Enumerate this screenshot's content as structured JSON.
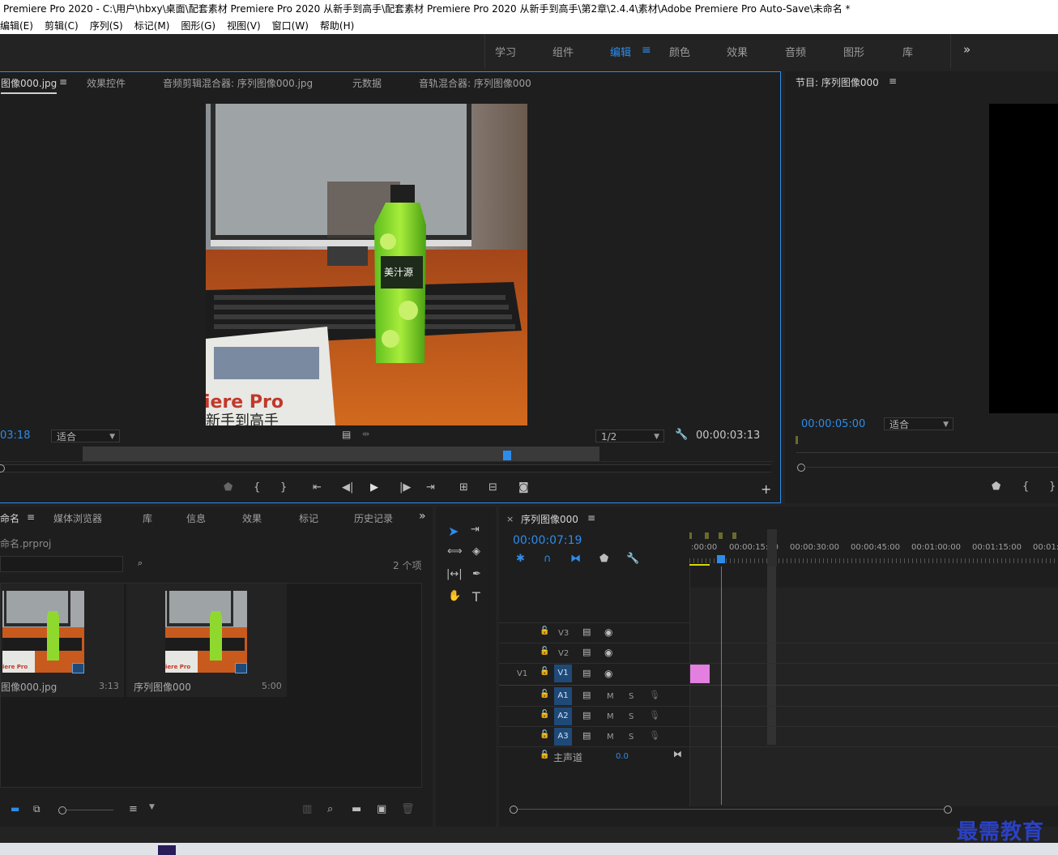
{
  "window": {
    "title": "Premiere Pro 2020 - C:\\用户\\hbxy\\桌面\\配套素材 Premiere Pro 2020 从新手到高手\\配套素材 Premiere Pro 2020 从新手到高手\\第2章\\2.4.4\\素材\\Adobe Premiere Pro Auto-Save\\未命名 *"
  },
  "menu": [
    "编辑(E)",
    "剪辑(C)",
    "序列(S)",
    "标记(M)",
    "图形(G)",
    "视图(V)",
    "窗口(W)",
    "帮助(H)"
  ],
  "workspaces": {
    "items": [
      "学习",
      "组件",
      "编辑",
      "颜色",
      "效果",
      "音频",
      "图形",
      "库"
    ],
    "active": "编辑",
    "more": "»"
  },
  "source_monitor": {
    "tabs": [
      "图像000.jpg",
      "效果控件",
      "音频剪辑混合器: 序列图像000.jpg",
      "元数据",
      "音轨混合器: 序列图像000"
    ],
    "timecode_left": "03:18",
    "fit": "适合",
    "resolution": "1/2",
    "timecode_right": "00:00:03:13",
    "add": "+"
  },
  "program_monitor": {
    "title": "节目: 序列图像000",
    "timecode": "00:00:05:00",
    "fit": "适合"
  },
  "project": {
    "tabs": [
      "命名",
      "媒体浏览器",
      "库",
      "信息",
      "效果",
      "标记",
      "历史记录"
    ],
    "more": "»",
    "filename": "命名.prproj",
    "count": "2 个项",
    "items": [
      {
        "name": "图像000.jpg",
        "duration": "3:13"
      },
      {
        "name": "序列图像000",
        "duration": "5:00"
      }
    ],
    "thumb_text": "iere Pro"
  },
  "timeline": {
    "close": "×",
    "title": "序列图像000",
    "timecode": "00:00:07:19",
    "ruler": [
      ":00:00",
      "00:00:15:00",
      "00:00:30:00",
      "00:00:45:00",
      "00:01:00:00",
      "00:01:15:00",
      "00:01:"
    ],
    "video_tracks": [
      {
        "id": "V3",
        "source": ""
      },
      {
        "id": "V2",
        "source": ""
      },
      {
        "id": "V1",
        "source": "V1"
      }
    ],
    "audio_tracks": [
      {
        "id": "A1",
        "m": "M",
        "s": "S"
      },
      {
        "id": "A2",
        "m": "M",
        "s": "S"
      },
      {
        "id": "A3",
        "m": "M",
        "s": "S"
      }
    ],
    "master": {
      "label": "主声道",
      "value": "0.0"
    },
    "clip_color": "#e27fdf"
  },
  "image_overlay": {
    "bottle_label": "美汁源",
    "book_text": "iere Pro",
    "book_text2": "新手到高手"
  },
  "watermark": "最需教育",
  "colors": {
    "accent": "#2d8ceb",
    "panel": "#1e1e1e",
    "bg": "#232323"
  }
}
